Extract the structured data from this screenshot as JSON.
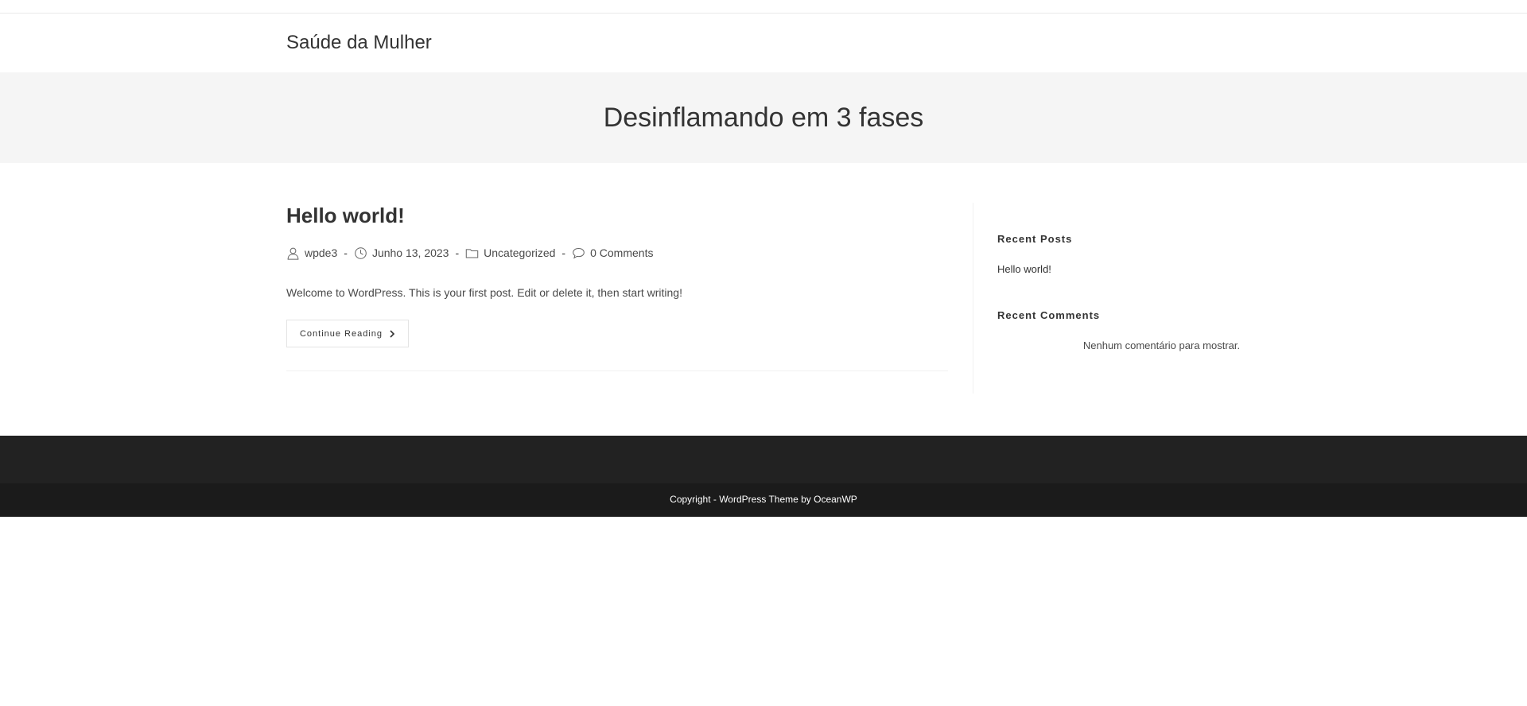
{
  "header": {
    "site_title": "Saúde da Mulher"
  },
  "page_header": {
    "title": "Desinflamando em 3 fases"
  },
  "post": {
    "title": "Hello world!",
    "meta": {
      "author": "wpde3",
      "date": "Junho 13, 2023",
      "category": "Uncategorized",
      "comments": "0 Comments",
      "separator": "-"
    },
    "excerpt": "Welcome to WordPress. This is your first post. Edit or delete it, then start writing!",
    "continue_label": "Continue Reading"
  },
  "sidebar": {
    "recent_posts": {
      "title": "Recent Posts",
      "items": [
        "Hello world!"
      ]
    },
    "recent_comments": {
      "title": "Recent Comments",
      "empty_text": "Nenhum comentário para mostrar."
    }
  },
  "footer": {
    "copyright": "Copyright - WordPress Theme by OceanWP"
  },
  "colors": {
    "page_header_bg": "#f5f5f5",
    "footer_widgets_bg": "#222222",
    "footer_bottom_bg": "#1b1b1b",
    "text": "#333333"
  }
}
